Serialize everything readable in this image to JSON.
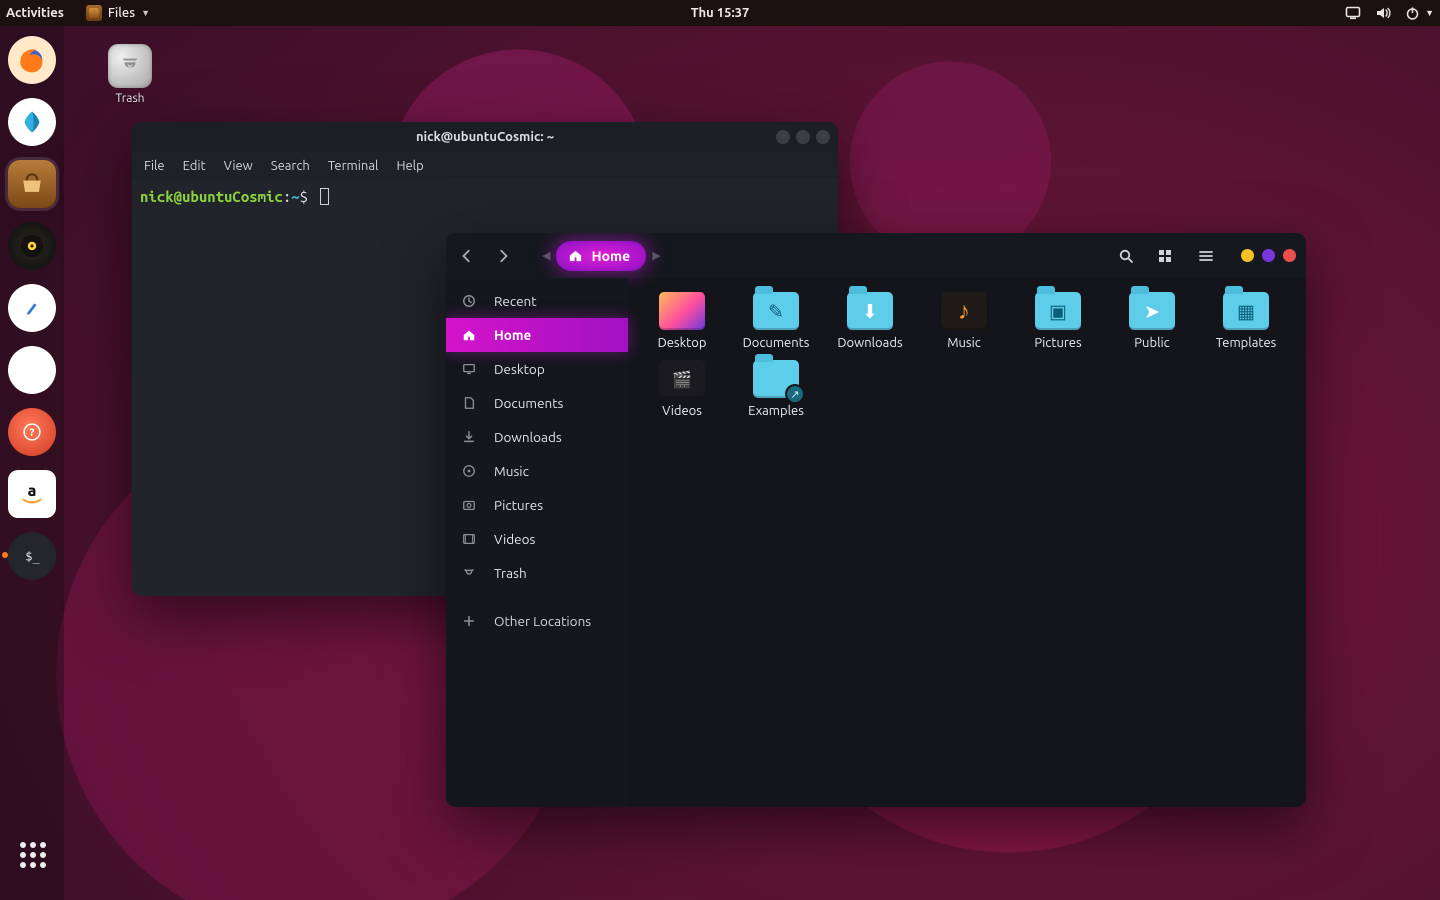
{
  "topbar": {
    "activities": "Activities",
    "app_name": "Files",
    "clock": "Thu 15:37"
  },
  "dock": {
    "items": [
      {
        "name": "firefox",
        "bg": "#ffe9c8",
        "fg": "#ff7a18"
      },
      {
        "name": "web-app",
        "bg": "#ffffff",
        "fg": "#2d9bd9"
      },
      {
        "name": "software-store",
        "bg": "#9a5a2a",
        "fg": "#efc27a",
        "active": true,
        "square": true
      },
      {
        "name": "rhythmbox",
        "bg": "#1c1b18",
        "fg": "#ffc83a"
      },
      {
        "name": "text-editor",
        "bg": "#ffffff",
        "fg": "#2d9bd9"
      },
      {
        "name": "settings-app",
        "bg": "#ffffff",
        "fg": "#f05a23"
      },
      {
        "name": "help",
        "bg": "#e44e39",
        "fg": "#ffffff"
      },
      {
        "name": "amazon",
        "bg": "#ffffff",
        "fg": "#111111"
      },
      {
        "name": "terminal-app",
        "bg": "#23262d",
        "fg": "#e6e8eb",
        "running": true
      }
    ]
  },
  "desktop": {
    "trash_label": "Trash"
  },
  "terminal": {
    "title": "nick@ubuntuCosmic: ~",
    "menu": [
      "File",
      "Edit",
      "View",
      "Search",
      "Terminal",
      "Help"
    ],
    "prompt": {
      "user": "nick",
      "host": "ubuntuCosmic",
      "path": "~",
      "symbol": "$"
    }
  },
  "files": {
    "path_label": "Home",
    "sidebar": [
      {
        "icon": "clock",
        "label": "Recent"
      },
      {
        "icon": "home",
        "label": "Home",
        "active": true
      },
      {
        "icon": "desktop",
        "label": "Desktop"
      },
      {
        "icon": "document",
        "label": "Documents"
      },
      {
        "icon": "download",
        "label": "Downloads"
      },
      {
        "icon": "music",
        "label": "Music"
      },
      {
        "icon": "pictures",
        "label": "Pictures"
      },
      {
        "icon": "videos",
        "label": "Videos"
      },
      {
        "icon": "trash",
        "label": "Trash"
      }
    ],
    "sidebar_other": {
      "icon": "plus",
      "label": "Other Locations"
    },
    "items": [
      {
        "label": "Desktop",
        "kind": "desktop"
      },
      {
        "label": "Documents",
        "kind": "folder",
        "glyph": "✎"
      },
      {
        "label": "Downloads",
        "kind": "folder",
        "glyph": "⬇"
      },
      {
        "label": "Music",
        "kind": "music",
        "glyph": "♪"
      },
      {
        "label": "Pictures",
        "kind": "folder",
        "glyph": "▣"
      },
      {
        "label": "Public",
        "kind": "folder",
        "glyph": "➤"
      },
      {
        "label": "Templates",
        "kind": "folder",
        "glyph": "▦"
      },
      {
        "label": "Videos",
        "kind": "videos",
        "glyph": "▶"
      },
      {
        "label": "Examples",
        "kind": "folder link",
        "glyph": ""
      }
    ]
  }
}
